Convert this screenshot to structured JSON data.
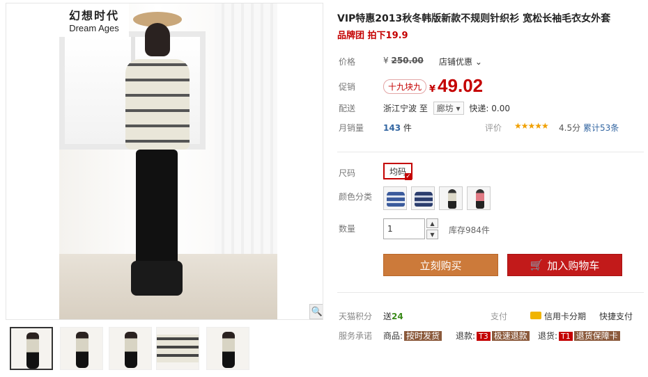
{
  "brand": {
    "cn": "幻想时代",
    "en": "Dream Ages"
  },
  "product": {
    "title": "VIP特惠2013秋冬韩版新款不规则针织衫 宽松长袖毛衣女外套",
    "subtitle": "品牌团 拍下19.9"
  },
  "price": {
    "label": "价格",
    "currency": "¥",
    "original": "250.00",
    "shop_promo": "店铺优惠"
  },
  "promo": {
    "label": "促销",
    "tag": "十九块九",
    "currency": "¥",
    "price": "49.02"
  },
  "shipping": {
    "label": "配送",
    "origin": "浙江宁波",
    "to": "至",
    "dest": "廊坊",
    "fee": "快递: 0.00"
  },
  "sales": {
    "label": "月销量",
    "count": "143",
    "unit": "件",
    "rating_label": "评价",
    "stars": "★★★★★",
    "score": "4.5分",
    "reviews": "累计53条"
  },
  "size": {
    "label": "尺码",
    "selected": "均码"
  },
  "color": {
    "label": "颜色分类",
    "swatches": [
      "sweater-blue",
      "sweater-navy",
      "model-grey",
      "model-pink"
    ]
  },
  "quantity": {
    "label": "数量",
    "value": "1",
    "stock": "库存984件"
  },
  "actions": {
    "buy": "立刻购买",
    "cart": "加入购物车"
  },
  "footer": {
    "points_label": "天猫积分",
    "points_prefix": "送",
    "points_value": "24",
    "pay_label": "支付",
    "card_installment": "信用卡分期",
    "quick_pay": "快捷支付",
    "service_label": "服务承诺",
    "goods_label": "商品:",
    "goods_tag": "按时发货",
    "refund_label": "退款:",
    "refund_code": "T3",
    "refund_tag": "极速退款",
    "return_label": "退货:",
    "return_code": "T1",
    "return_tag": "退货保障卡"
  },
  "colors": {
    "accent_red": "#c40000",
    "buy_orange": "#cc7a3a",
    "cart_red": "#c21a1a",
    "link_blue": "#3366a2"
  }
}
